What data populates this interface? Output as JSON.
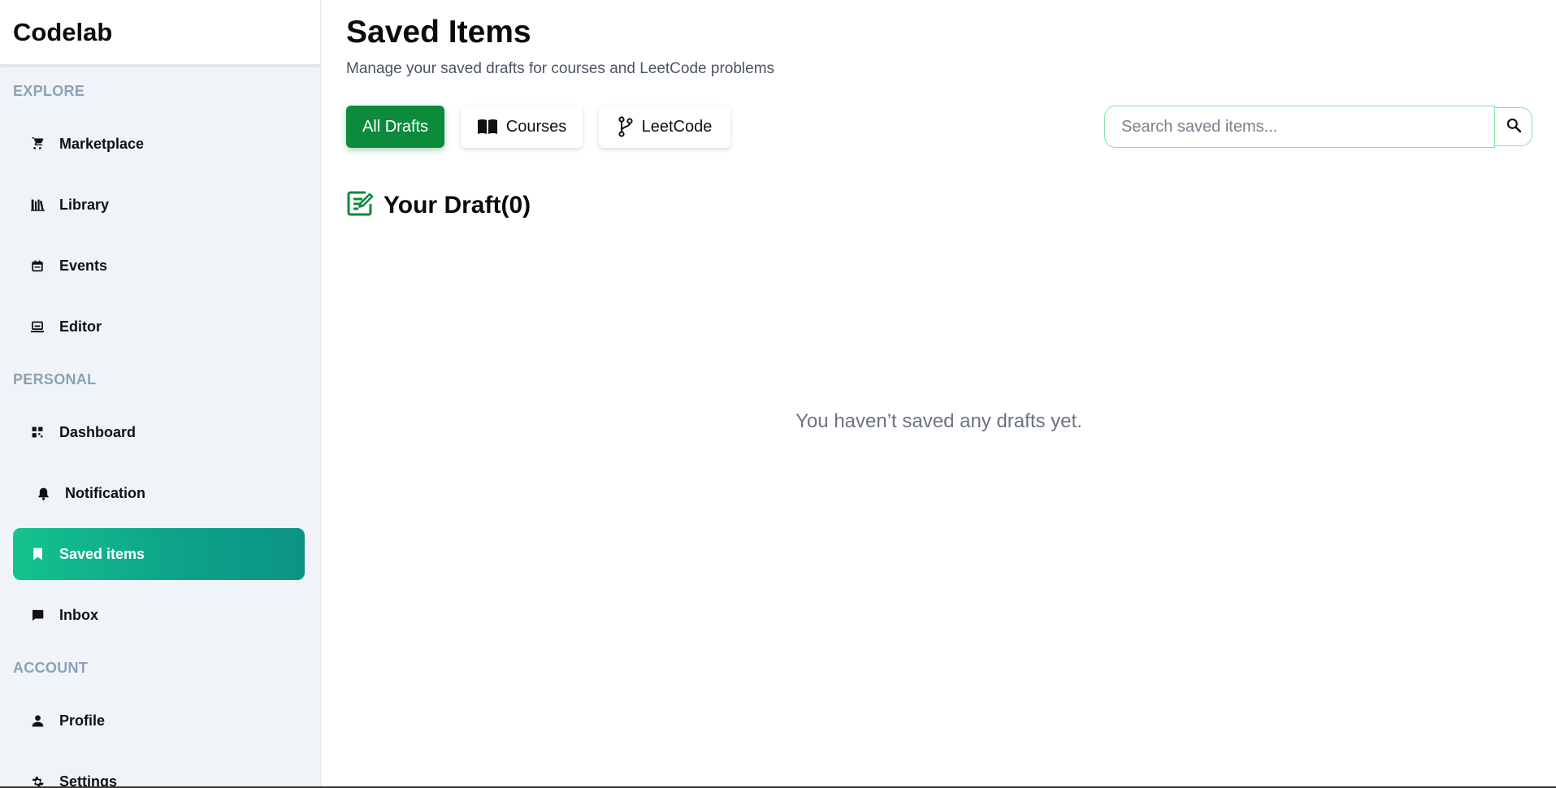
{
  "app": {
    "brand": "Codelab"
  },
  "sidebar": {
    "sections": {
      "explore": "EXPLORE",
      "personal": "PERSONAL",
      "account": "ACCOUNT"
    },
    "items": [
      {
        "label": "Marketplace",
        "icon": "cart-icon"
      },
      {
        "label": "Library",
        "icon": "library-icon"
      },
      {
        "label": "Events",
        "icon": "calendar-icon"
      },
      {
        "label": "Editor",
        "icon": "laptop-icon"
      },
      {
        "label": "Dashboard",
        "icon": "dashboard-icon"
      },
      {
        "label": "Notification",
        "icon": "bell-icon"
      },
      {
        "label": "Saved items",
        "icon": "bookmark-icon",
        "active": true
      },
      {
        "label": "Inbox",
        "icon": "chat-icon"
      },
      {
        "label": "Profile",
        "icon": "person-icon"
      },
      {
        "label": "Settings",
        "icon": "gear-icon"
      }
    ]
  },
  "main": {
    "title": "Saved Items",
    "subtitle": "Manage your saved drafts for courses and LeetCode problems",
    "filters": [
      {
        "label": "All Drafts",
        "active": true
      },
      {
        "label": "Courses",
        "icon": "book-icon"
      },
      {
        "label": "LeetCode",
        "icon": "git-branch-icon"
      }
    ],
    "search": {
      "placeholder": "Search saved items...",
      "value": ""
    },
    "drafts_heading": "Your Draft(0)",
    "empty_message": "You haven’t saved any drafts yet."
  },
  "colors": {
    "accent": "#0d8a3c",
    "active_gradient_start": "#14c38e",
    "active_gradient_end": "#0b9484",
    "sidebar_bg": "#f0f4f8",
    "section_label": "#8fa0b5",
    "search_border": "#86e0a8"
  }
}
